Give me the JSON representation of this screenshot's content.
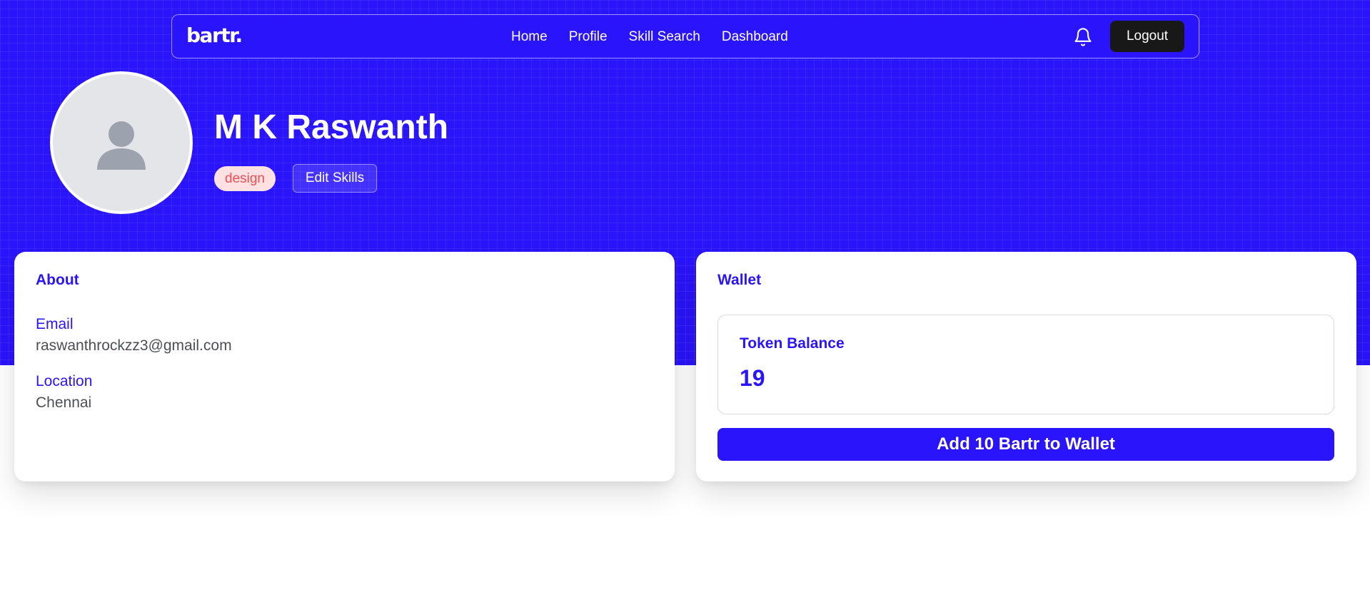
{
  "colors": {
    "brand": "#2a14fc",
    "logout_bg": "#181818",
    "tag_bg": "#ffe1e4",
    "tag_text": "#ef4f55"
  },
  "navbar": {
    "logo": "bartr.",
    "links": [
      "Home",
      "Profile",
      "Skill Search",
      "Dashboard"
    ],
    "notification_icon": "bell-icon",
    "logout_label": "Logout"
  },
  "profile": {
    "avatar_icon": "user-placeholder-icon",
    "name": "M K Raswanth",
    "skills": [
      "design"
    ],
    "edit_skills_label": "Edit Skills"
  },
  "about": {
    "title": "About",
    "email_label": "Email",
    "email": "raswanthrockzz3@gmail.com",
    "location_label": "Location",
    "location": "Chennai"
  },
  "wallet": {
    "title": "Wallet",
    "token_balance_label": "Token Balance",
    "token_balance": "19",
    "add_button_label": "Add 10 Bartr to Wallet"
  }
}
